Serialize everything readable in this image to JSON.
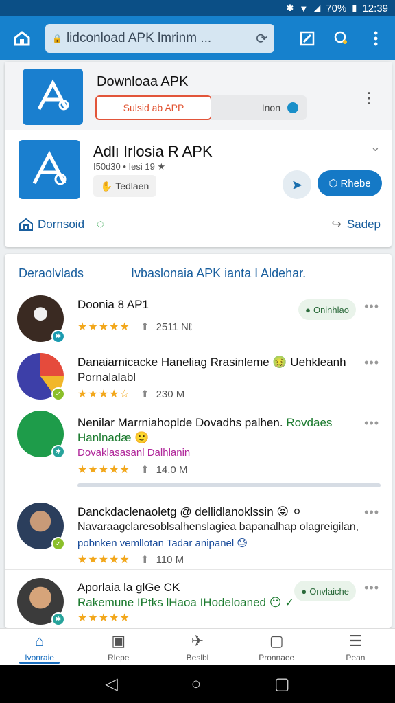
{
  "status_bar": {
    "battery": "70%",
    "time": "12:39"
  },
  "toolbar": {
    "url": "lidconload APK lmrinm ..."
  },
  "top_card": {
    "title": "Downloaa APK",
    "submit_label": "Sulsid ab APP",
    "pill_label": "Inon",
    "app_name": "Adlı Irlosia R APK",
    "app_meta": "I50d30 • Iesi 19 ★",
    "tag_label": "Tedlaen",
    "install_label": "Rhebe",
    "download_label": "Dornsoid",
    "share_label": "Sadep"
  },
  "list": {
    "header_left": "Deraolvlads",
    "header_right": "Ivbaslonaia APK ianta I Aldehar.",
    "items": [
      {
        "title": "Doonia 8 AP1",
        "line2": "",
        "line3": "",
        "stars": "★★★★★",
        "downloads": "2511 Nℓ",
        "chip": "Oninhlao"
      },
      {
        "title": "Danaiarnicacke Haneliag Rrasinleme 🤢 Uehkleanh",
        "line2": "Pornalalabl",
        "line3": "",
        "stars": "★★★★☆",
        "downloads": "230 M",
        "chip": ""
      },
      {
        "title": "Nenilar Marrniahoplde Dovadhs palhen.",
        "title_extra": "Rovdaes",
        "line2": "Hanlnadæ 🙂",
        "line3": "Dovaklasasanl Dalhlanin",
        "stars": "★★★★★",
        "downloads": "14.0 M",
        "chip": ""
      },
      {
        "title": "Danckdaclenaoletg @ dellidlanoklssin 😝 ⚪",
        "line2": "Navaraagclaresoblsalhenslagiea bapanalhap olagreigilan,",
        "line3": "pobnken vemllotan Tadar anipanel 😓",
        "stars": "★★★★★",
        "downloads": "110 M",
        "chip": ""
      },
      {
        "title": "Aporlaia la glGe CK",
        "line2": "Rakemune IPtks lHaoa IHodeloaned 😶 ✓",
        "line3": "",
        "stars": "★★★★★",
        "downloads": "",
        "chip": "Onvlaiche"
      }
    ]
  },
  "bottom_nav": [
    {
      "label": "Ivonraie",
      "icon": "home-icon"
    },
    {
      "label": "Rlepe",
      "icon": "apps-icon"
    },
    {
      "label": "Beslbl",
      "icon": "games-icon"
    },
    {
      "label": "Pronnaee",
      "icon": "tablet-icon"
    },
    {
      "label": "Pean",
      "icon": "menu-icon"
    }
  ]
}
